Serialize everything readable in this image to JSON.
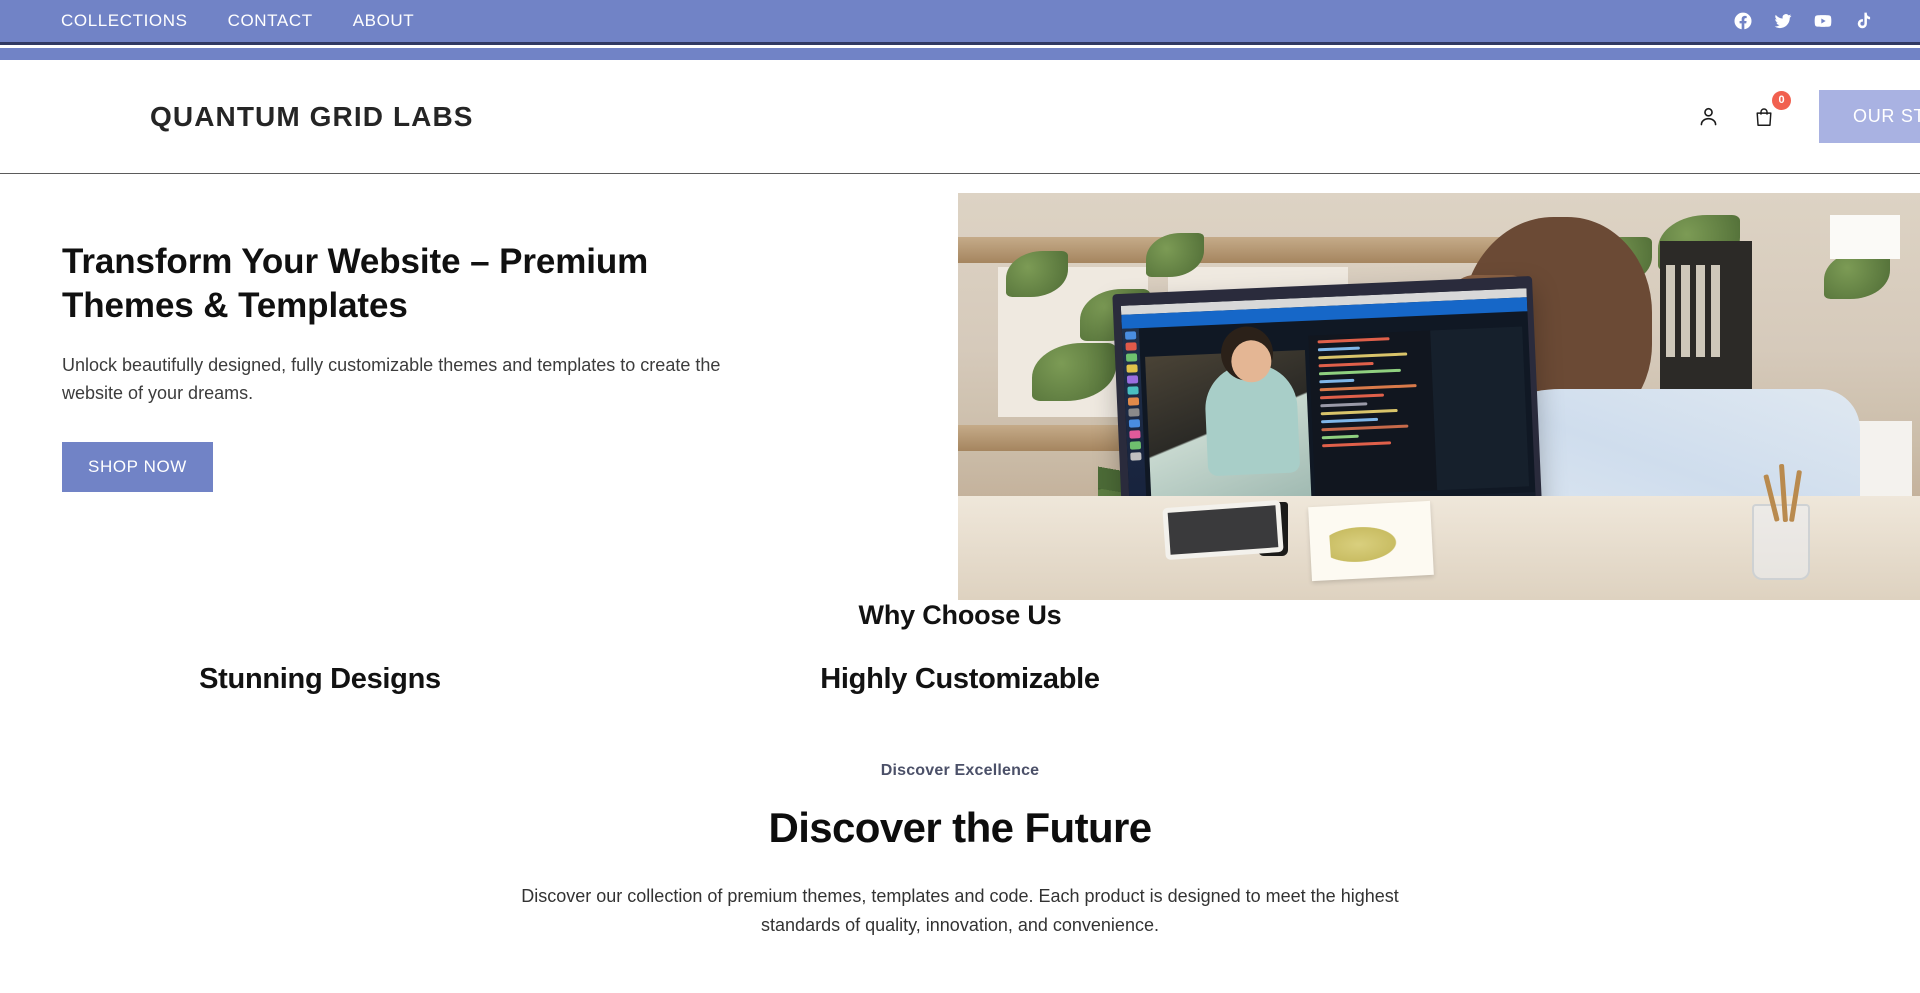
{
  "topbar": {
    "nav": [
      {
        "label": "COLLECTIONS",
        "name": "topbar-link-collections"
      },
      {
        "label": "CONTACT",
        "name": "topbar-link-contact"
      },
      {
        "label": "ABOUT",
        "name": "topbar-link-about"
      }
    ],
    "social": [
      {
        "icon": "facebook-icon",
        "label": "Facebook"
      },
      {
        "icon": "twitter-icon",
        "label": "Twitter"
      },
      {
        "icon": "youtube-icon",
        "label": "YouTube"
      },
      {
        "icon": "tiktok-icon",
        "label": "TikTok"
      }
    ],
    "background_color": "#7183c6",
    "separator_color": "#313a63"
  },
  "header": {
    "brand": "QUANTUM GRID LABS",
    "account_icon": "user-account-icon",
    "cart_icon": "shopping-bag-icon",
    "cart_count": "0",
    "cart_badge_color": "#f1604f",
    "store_button_label": "OUR STORE",
    "store_button_color": "#a9b2e2",
    "border_color": "#5b5b5b"
  },
  "hero": {
    "title": "Transform Your Website – Premium Themes & Templates",
    "subtitle": "Unlock beautifully designed, fully customizable themes and templates to create the website of your dreams.",
    "cta_label": "SHOP NOW",
    "cta_color": "#7183c6",
    "image_alt": "Man at desk working on an iMac with code editor and video call, surrounded by plants"
  },
  "why_choose_us": {
    "title": "Why Choose Us",
    "items": [
      {
        "label": "Stunning Designs"
      },
      {
        "label": "Highly Customizable"
      },
      {
        "label": ""
      }
    ]
  },
  "discover": {
    "eyebrow": "Discover Excellence",
    "eyebrow_color": "#4b5068",
    "title": "Discover the Future",
    "text": "Discover our collection of premium themes, templates and code. Each product is designed to meet the highest standards of quality, innovation, and convenience."
  }
}
